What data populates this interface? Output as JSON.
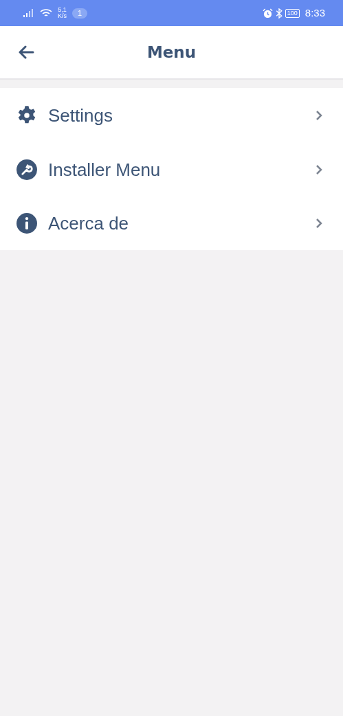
{
  "status_bar": {
    "speed_value": "5,1",
    "speed_unit": "K/s",
    "notification_count": "1",
    "battery": "100",
    "time": "8:33"
  },
  "header": {
    "title": "Menu"
  },
  "menu_items": [
    {
      "label": "Settings",
      "kind": "gear"
    },
    {
      "label": "Installer Menu",
      "kind": "wrench"
    },
    {
      "label": "Acerca de",
      "kind": "info"
    }
  ]
}
